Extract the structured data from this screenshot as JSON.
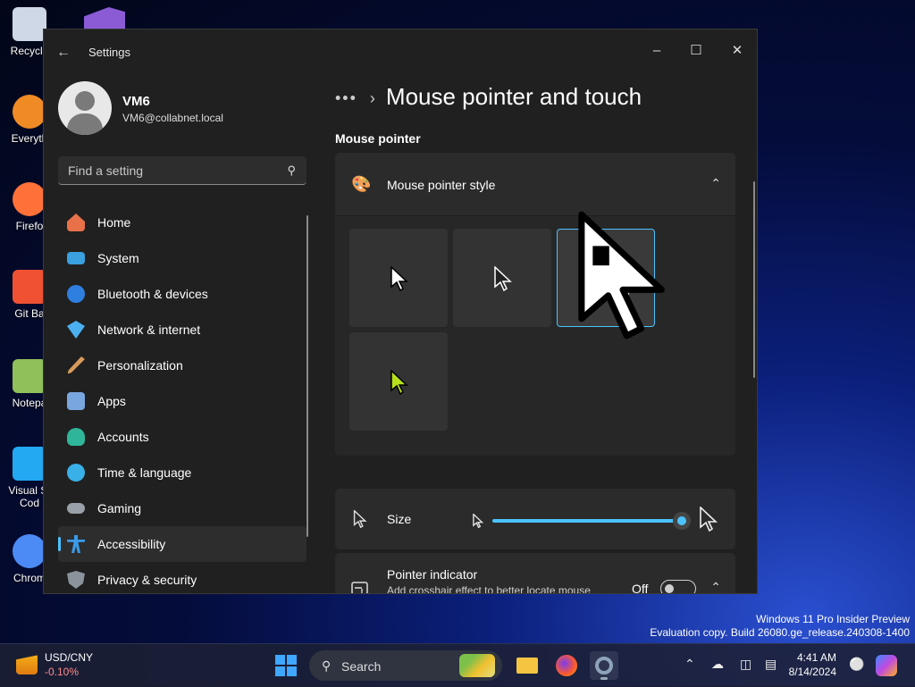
{
  "desktop": {
    "icons": [
      {
        "label": "Recycle",
        "color": "#cfd8e6"
      },
      {
        "label": "Everyth",
        "color": "#f08a24"
      },
      {
        "label": "Firefo",
        "color": "#ff7139"
      },
      {
        "label": "Git Ba",
        "color": "#f05133"
      },
      {
        "label": "Notepa",
        "color": "#8fc05a"
      },
      {
        "label": "Visual St Cod",
        "color": "#23a9f2"
      },
      {
        "label": "Chrom",
        "color": "#4c8bf5"
      }
    ],
    "watermark": {
      "line1": "Windows 11 Pro Insider Preview",
      "line2": "Evaluation copy. Build 26080.ge_release.240308-1400"
    }
  },
  "window": {
    "title": "Settings",
    "user": {
      "name": "VM6",
      "email": "VM6@collabnet.local"
    },
    "search": {
      "placeholder": "Find a setting"
    },
    "nav": [
      {
        "label": "Home",
        "icon": "home-icon",
        "color": "#e8714a"
      },
      {
        "label": "System",
        "icon": "system-icon",
        "color": "#3aa0e0"
      },
      {
        "label": "Bluetooth & devices",
        "icon": "bluetooth-icon",
        "color": "#2f7fe0"
      },
      {
        "label": "Network & internet",
        "icon": "wifi-icon",
        "color": "#4cb0f0"
      },
      {
        "label": "Personalization",
        "icon": "brush-icon",
        "color": "#d89a5a"
      },
      {
        "label": "Apps",
        "icon": "apps-icon",
        "color": "#7aa6e0"
      },
      {
        "label": "Accounts",
        "icon": "accounts-icon",
        "color": "#2fb59a"
      },
      {
        "label": "Time & language",
        "icon": "globe-clock-icon",
        "color": "#3ab0e8"
      },
      {
        "label": "Gaming",
        "icon": "gamepad-icon",
        "color": "#9aa0a8"
      },
      {
        "label": "Accessibility",
        "icon": "accessibility-icon",
        "color": "#3a9be8"
      },
      {
        "label": "Privacy & security",
        "icon": "shield-icon",
        "color": "#8a929c"
      }
    ],
    "selected_nav": "Accessibility",
    "breadcrumb": {
      "ellipsis": "•••",
      "page_title": "Mouse pointer and touch"
    },
    "section_title": "Mouse pointer",
    "pointer_style": {
      "label": "Mouse pointer style",
      "selected": 2
    },
    "size": {
      "label": "Size",
      "value": 1.0
    },
    "indicator": {
      "title": "Pointer indicator",
      "description": "Add crosshair effect to better locate mouse pointer (Keyboard shortcut: Win + Ctrl + X)",
      "state": "Off"
    },
    "accent": "#4cc2ff"
  },
  "taskbar": {
    "widget": {
      "title": "USD/CNY",
      "change": "-0.10%"
    },
    "search_label": "Search",
    "clock": {
      "time": "4:41 AM",
      "date": "8/14/2024"
    }
  }
}
